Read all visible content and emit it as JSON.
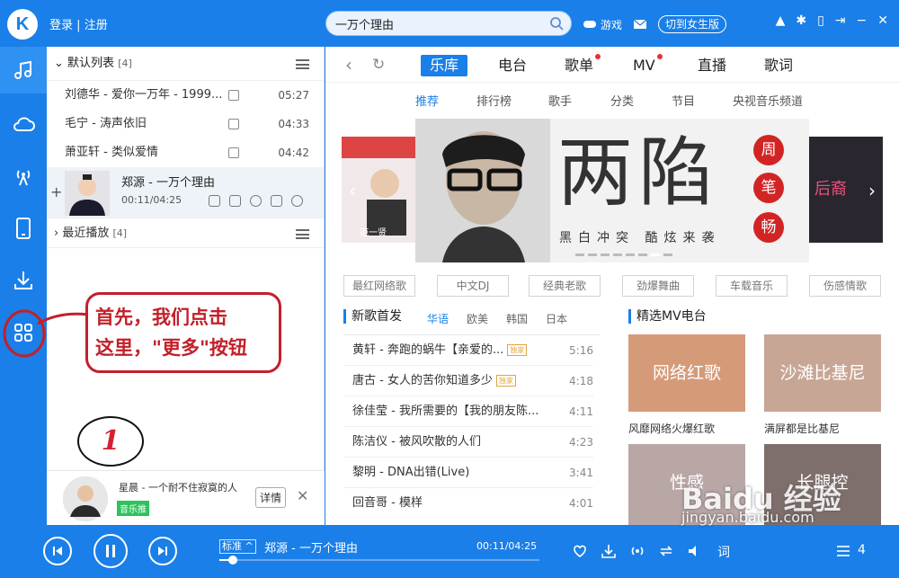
{
  "app": {
    "logo": "K",
    "login": "登录",
    "register": "注册",
    "sep": "|"
  },
  "search": {
    "value": "一万个理由",
    "icon": "search-icon"
  },
  "top_actions": {
    "game": "游戏",
    "mode": "切到女生版"
  },
  "sidebar": {
    "items": [
      "music-note-icon",
      "cloud-icon",
      "radio-icon",
      "phone-icon",
      "download-icon",
      "grid-icon"
    ]
  },
  "playlist": {
    "title": "默认列表",
    "count": "[4]",
    "songs": [
      {
        "title": "刘德华 - 爱你一万年 - 1999...",
        "dur": "05:27"
      },
      {
        "title": "毛宁 - 涛声依旧",
        "dur": "04:33"
      },
      {
        "title": "萧亚轩 - 类似爱情",
        "dur": "04:42"
      }
    ],
    "now": {
      "title": "郑源 - 一万个理由",
      "time": "00:11/04:25",
      "plus": "+"
    },
    "recent": {
      "title": "最近播放",
      "count": "[4]"
    }
  },
  "annotation": {
    "line1": "首先，我们点击",
    "line2": "这里，\"更多\"按钮",
    "circle": "1"
  },
  "recommend": {
    "text": "星晨 - 一个耐不住寂寞的人",
    "tag": "音乐推",
    "detail": "详情",
    "close": "✕"
  },
  "tabs": [
    {
      "label": "乐库",
      "dot": false
    },
    {
      "label": "电台",
      "dot": false
    },
    {
      "label": "歌单",
      "dot": true
    },
    {
      "label": "MV",
      "dot": true
    },
    {
      "label": "直播",
      "dot": false
    },
    {
      "label": "歌词",
      "dot": false
    }
  ],
  "subtabs": [
    "推荐",
    "排行榜",
    "歌手",
    "分类",
    "节目",
    "央视音乐频道"
  ],
  "banner": {
    "big": "两陷",
    "sub": "黑白冲突  酷炫来袭",
    "circles": [
      "周",
      "笔",
      "畅"
    ],
    "left_text": "范一贤",
    "right_text": "后裔"
  },
  "chips": [
    "最红网络歌",
    "中文DJ",
    "经典老歌",
    "劲爆舞曲",
    "车载音乐",
    "伤感情歌"
  ],
  "new_songs": {
    "title": "新歌首发",
    "langs": [
      "华语",
      "欧美",
      "韩国",
      "日本"
    ],
    "list": [
      {
        "title": "黄轩 - 奔跑的蜗牛【亲爱的...",
        "badge": "独家",
        "dur": "5:16"
      },
      {
        "title": "唐古 - 女人的苦你知道多少",
        "badge": "独家",
        "dur": "4:18"
      },
      {
        "title": "徐佳莹 - 我所需要的【我的朋友陈...",
        "badge": "",
        "dur": "4:11"
      },
      {
        "title": "陈洁仪 - 被风吹散的人们",
        "badge": "",
        "dur": "4:23"
      },
      {
        "title": "黎明 - DNA出错(Live)",
        "badge": "",
        "dur": "3:41"
      },
      {
        "title": "回音哥 - 模样",
        "badge": "",
        "dur": "4:01"
      }
    ]
  },
  "mv": {
    "title": "精选MV电台",
    "items": [
      {
        "label": "网络红歌",
        "caption": "风靡网络火爆红歌"
      },
      {
        "label": "沙滩比基尼",
        "caption": "满屏都是比基尼"
      },
      {
        "label": "性感",
        "caption": ""
      },
      {
        "label": "长腿控",
        "caption": ""
      }
    ]
  },
  "player": {
    "quality": "标准",
    "title": "郑源 - 一万个理由",
    "time": "00:11/04:25",
    "progress": 0.04,
    "queue": "4"
  },
  "watermark": {
    "main": "Baidu 经验",
    "sub": "jingyan.baidu.com"
  }
}
